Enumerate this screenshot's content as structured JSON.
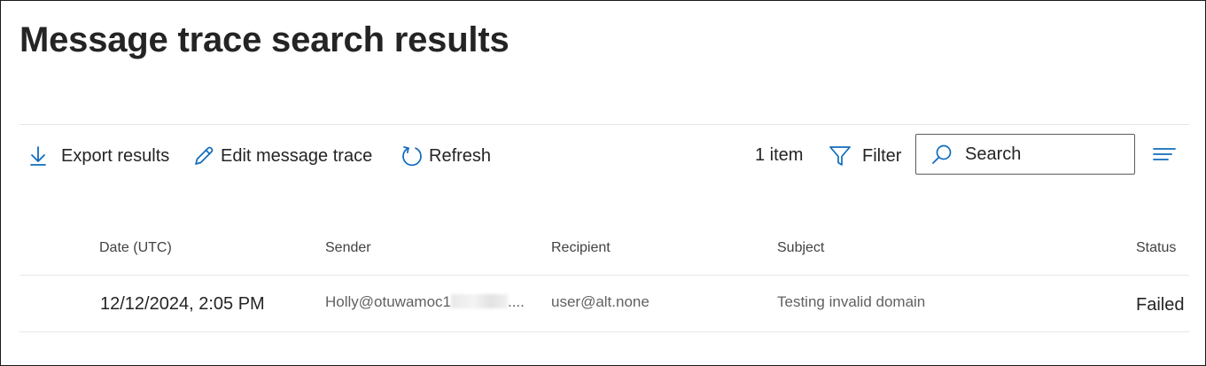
{
  "page": {
    "title": "Message trace search results"
  },
  "toolbar": {
    "export_label": "Export results",
    "edit_label": "Edit message trace",
    "refresh_label": "Refresh",
    "item_count": "1 item",
    "filter_label": "Filter",
    "search_placeholder": "Search",
    "accent_color": "#0f6cbd"
  },
  "table": {
    "columns": [
      "Date (UTC)",
      "Sender",
      "Recipient",
      "Subject",
      "Status"
    ],
    "rows": [
      {
        "date": "12/12/2024, 2:05 PM",
        "sender": "Holly@otuwamoc1",
        "sender_ellipsis": "....",
        "recipient": "user@alt.none",
        "subject": "Testing invalid domain",
        "status": "Failed"
      }
    ]
  }
}
